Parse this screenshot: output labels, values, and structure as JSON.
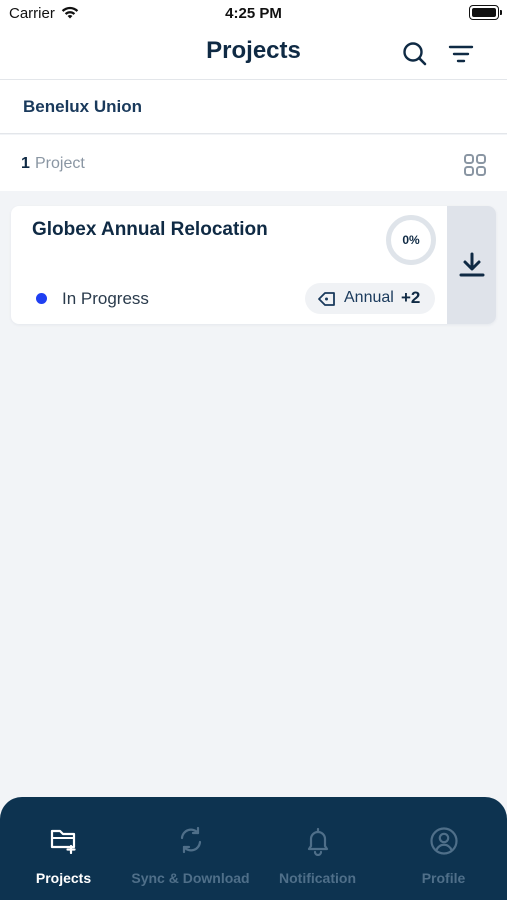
{
  "status_bar": {
    "carrier": "Carrier",
    "time": "4:25 PM"
  },
  "header": {
    "title": "Projects",
    "icons": [
      "search-icon",
      "filter-icon"
    ]
  },
  "organization": {
    "name": "Benelux Union"
  },
  "project_count": {
    "number": "1",
    "label": "Project"
  },
  "projects": [
    {
      "title": "Globex Annual Relocation",
      "progress_text": "0%",
      "progress": 0,
      "status": "In Progress",
      "status_color": "#1f3ff2",
      "tag": "Annual",
      "more_tags": "+2"
    }
  ],
  "tab_bar": {
    "tabs": [
      {
        "label": "Projects",
        "icon": "folder-add-icon",
        "active": true
      },
      {
        "label": "Sync & Download",
        "icon": "sync-icon",
        "active": false
      },
      {
        "label": "Notification",
        "icon": "bell-icon",
        "active": false
      },
      {
        "label": "Profile",
        "icon": "user-circle-icon",
        "active": false
      }
    ]
  },
  "colors": {
    "primary": "#0f2a44",
    "tab_bar_bg": "#0d3350",
    "inactive_tab": "#4f6f89",
    "status_dot": "#1f3ff2",
    "page_bg": "#f2f4f7"
  }
}
